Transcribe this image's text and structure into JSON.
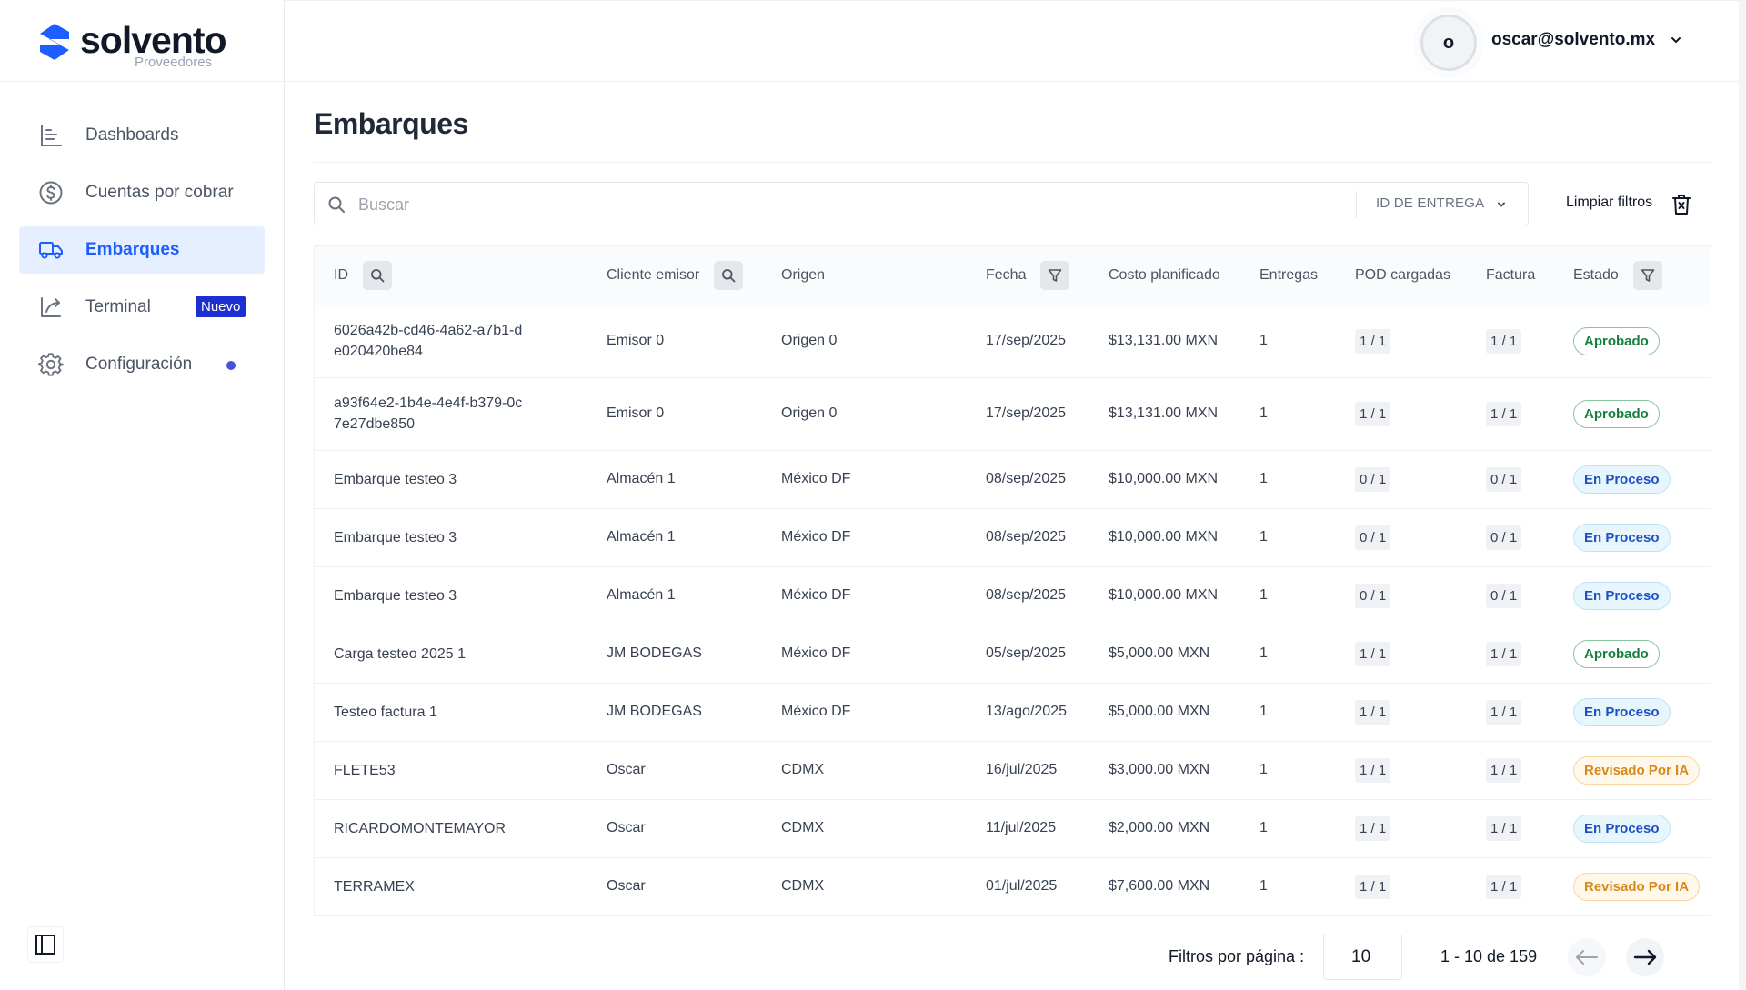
{
  "brand": {
    "name": "solvento",
    "subtitle": "Proveedores",
    "color": "#1e5eff"
  },
  "sidebar": {
    "items": [
      {
        "label": "Dashboards",
        "icon": "bar-chart-icon",
        "active": false
      },
      {
        "label": "Cuentas por cobrar",
        "icon": "dollar-circle-icon",
        "active": false
      },
      {
        "label": "Embarques",
        "icon": "truck-icon",
        "active": true
      },
      {
        "label": "Terminal",
        "icon": "terminal-arrow-icon",
        "active": false,
        "badge": "Nuevo"
      },
      {
        "label": "Configuración",
        "icon": "gear-icon",
        "active": false,
        "dot": true
      }
    ],
    "collapse_icon": "sidebar-toggle-icon"
  },
  "header": {
    "avatar_initial": "o",
    "user_email": "oscar@solvento.mx"
  },
  "main": {
    "title": "Embarques",
    "search": {
      "placeholder": "Buscar",
      "value": ""
    },
    "search_field_select": "ID DE ENTREGA",
    "clear_filters_label": "Limpiar filtros"
  },
  "table": {
    "columns": [
      "ID",
      "Cliente emisor",
      "Origen",
      "Fecha",
      "Costo planificado",
      "Entregas",
      "POD cargadas",
      "Factura",
      "Estado"
    ],
    "rows": [
      {
        "id": "6026a42b-cd46-4a62-a7b1-de020420be84",
        "cliente": "Emisor 0",
        "origen": "Origen 0",
        "fecha": "17/sep/2025",
        "costo": "$13,131.00 MXN",
        "entregas": "1",
        "pod": "1 / 1",
        "factura": "1 / 1",
        "estado": "Aprobado"
      },
      {
        "id": "a93f64e2-1b4e-4e4f-b379-0c7e27dbe850",
        "cliente": "Emisor 0",
        "origen": "Origen 0",
        "fecha": "17/sep/2025",
        "costo": "$13,131.00 MXN",
        "entregas": "1",
        "pod": "1 / 1",
        "factura": "1 / 1",
        "estado": "Aprobado"
      },
      {
        "id": "Embarque testeo 3",
        "cliente": "Almacén 1",
        "origen": "México DF",
        "fecha": "08/sep/2025",
        "costo": "$10,000.00 MXN",
        "entregas": "1",
        "pod": "0 / 1",
        "factura": "0 / 1",
        "estado": "En Proceso"
      },
      {
        "id": "Embarque testeo 3",
        "cliente": "Almacén 1",
        "origen": "México DF",
        "fecha": "08/sep/2025",
        "costo": "$10,000.00 MXN",
        "entregas": "1",
        "pod": "0 / 1",
        "factura": "0 / 1",
        "estado": "En Proceso"
      },
      {
        "id": "Embarque testeo 3",
        "cliente": "Almacén 1",
        "origen": "México DF",
        "fecha": "08/sep/2025",
        "costo": "$10,000.00 MXN",
        "entregas": "1",
        "pod": "0 / 1",
        "factura": "0 / 1",
        "estado": "En Proceso"
      },
      {
        "id": "Carga testeo 2025 1",
        "cliente": "JM BODEGAS",
        "origen": "México DF",
        "fecha": "05/sep/2025",
        "costo": "$5,000.00 MXN",
        "entregas": "1",
        "pod": "1 / 1",
        "factura": "1 / 1",
        "estado": "Aprobado"
      },
      {
        "id": "Testeo factura 1",
        "cliente": "JM BODEGAS",
        "origen": "México DF",
        "fecha": "13/ago/2025",
        "costo": "$5,000.00 MXN",
        "entregas": "1",
        "pod": "1 / 1",
        "factura": "1 / 1",
        "estado": "En Proceso"
      },
      {
        "id": "FLETE53",
        "cliente": "Oscar",
        "origen": "CDMX",
        "fecha": "16/jul/2025",
        "costo": "$3,000.00 MXN",
        "entregas": "1",
        "pod": "1 / 1",
        "factura": "1 / 1",
        "estado": "Revisado Por IA"
      },
      {
        "id": "RICARDOMONTEMAYOR",
        "cliente": "Oscar",
        "origen": "CDMX",
        "fecha": "11/jul/2025",
        "costo": "$2,000.00 MXN",
        "entregas": "1",
        "pod": "1 / 1",
        "factura": "1 / 1",
        "estado": "En Proceso"
      },
      {
        "id": "TERRAMEX",
        "cliente": "Oscar",
        "origen": "CDMX",
        "fecha": "01/jul/2025",
        "costo": "$7,600.00 MXN",
        "entregas": "1",
        "pod": "1 / 1",
        "factura": "1 / 1",
        "estado": "Revisado Por IA"
      }
    ],
    "status_colors": {
      "Aprobado": "#15803d",
      "En Proceso": "#1e4fc4",
      "Revisado Por IA": "#d58a1d"
    }
  },
  "pagination": {
    "per_page_label": "Filtros por página :",
    "per_page_value": "10",
    "range_label": "1 - 10 de 159"
  }
}
